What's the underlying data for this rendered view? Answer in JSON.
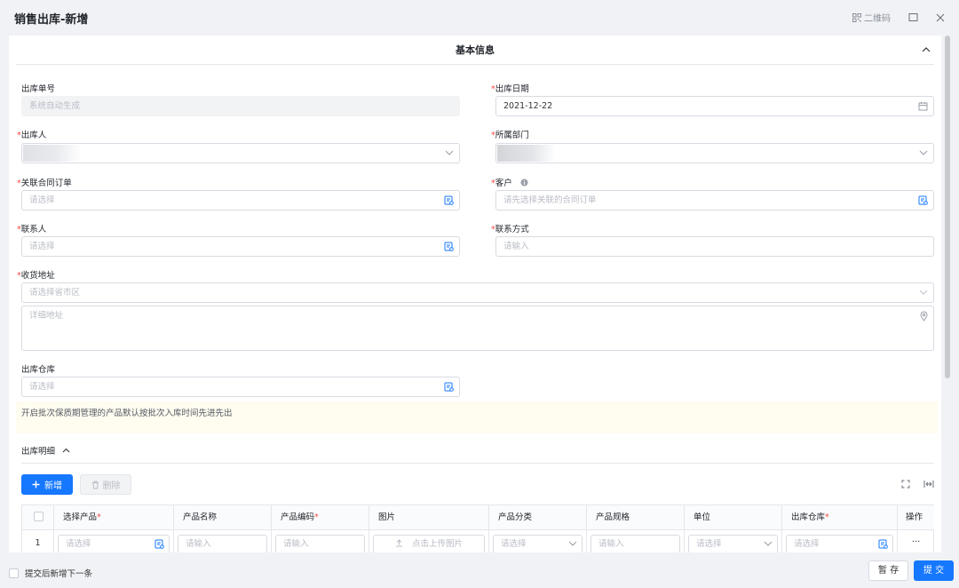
{
  "header": {
    "title": "销售出库-新增",
    "qr_label": "二维码"
  },
  "section": {
    "title": "基本信息"
  },
  "form": {
    "order_no": {
      "label": "出库单号",
      "placeholder": "系统自动生成"
    },
    "date": {
      "label": "出库日期",
      "value": "2021-12-22"
    },
    "person": {
      "label": "出库人"
    },
    "department": {
      "label": "所属部门"
    },
    "contract": {
      "label": "关联合同订单",
      "placeholder": "请选择"
    },
    "customer": {
      "label": "客户",
      "placeholder": "请先选择关联的合同订单"
    },
    "contact": {
      "label": "联系人",
      "placeholder": "请选择"
    },
    "contact_method": {
      "label": "联系方式",
      "placeholder": "请输入"
    },
    "address": {
      "label": "收货地址",
      "region_placeholder": "请选择省市区",
      "detail_placeholder": "详细地址"
    },
    "warehouse": {
      "label": "出库仓库",
      "placeholder": "请选择"
    }
  },
  "notice": "开启批次保质期管理的产品默认按批次入库时间先进先出",
  "details": {
    "title": "出库明细",
    "add_label": "新增",
    "delete_label": "删除",
    "columns": [
      {
        "label": "选择产品",
        "required": true
      },
      {
        "label": "产品名称",
        "required": false
      },
      {
        "label": "产品编码",
        "required": true
      },
      {
        "label": "图片",
        "required": false
      },
      {
        "label": "产品分类",
        "required": false
      },
      {
        "label": "产品规格",
        "required": false
      },
      {
        "label": "单位",
        "required": false
      },
      {
        "label": "出库仓库",
        "required": true
      },
      {
        "label": "操作",
        "required": false
      }
    ],
    "row": {
      "index": "1",
      "product_placeholder": "请选择",
      "name_placeholder": "请输入",
      "code_placeholder": "请输入",
      "upload_label": "点击上传图片",
      "category_placeholder": "请选择",
      "spec_placeholder": "请输入",
      "unit_placeholder": "请选择",
      "warehouse_placeholder": "请选择",
      "more": "···"
    }
  },
  "footer": {
    "continue_label": "提交后新增下一条",
    "save_label": "暂 存",
    "submit_label": "提 交"
  },
  "colors": {
    "primary": "#1677ff",
    "required": "#f54a45",
    "notice_bg": "#fffcf0"
  }
}
